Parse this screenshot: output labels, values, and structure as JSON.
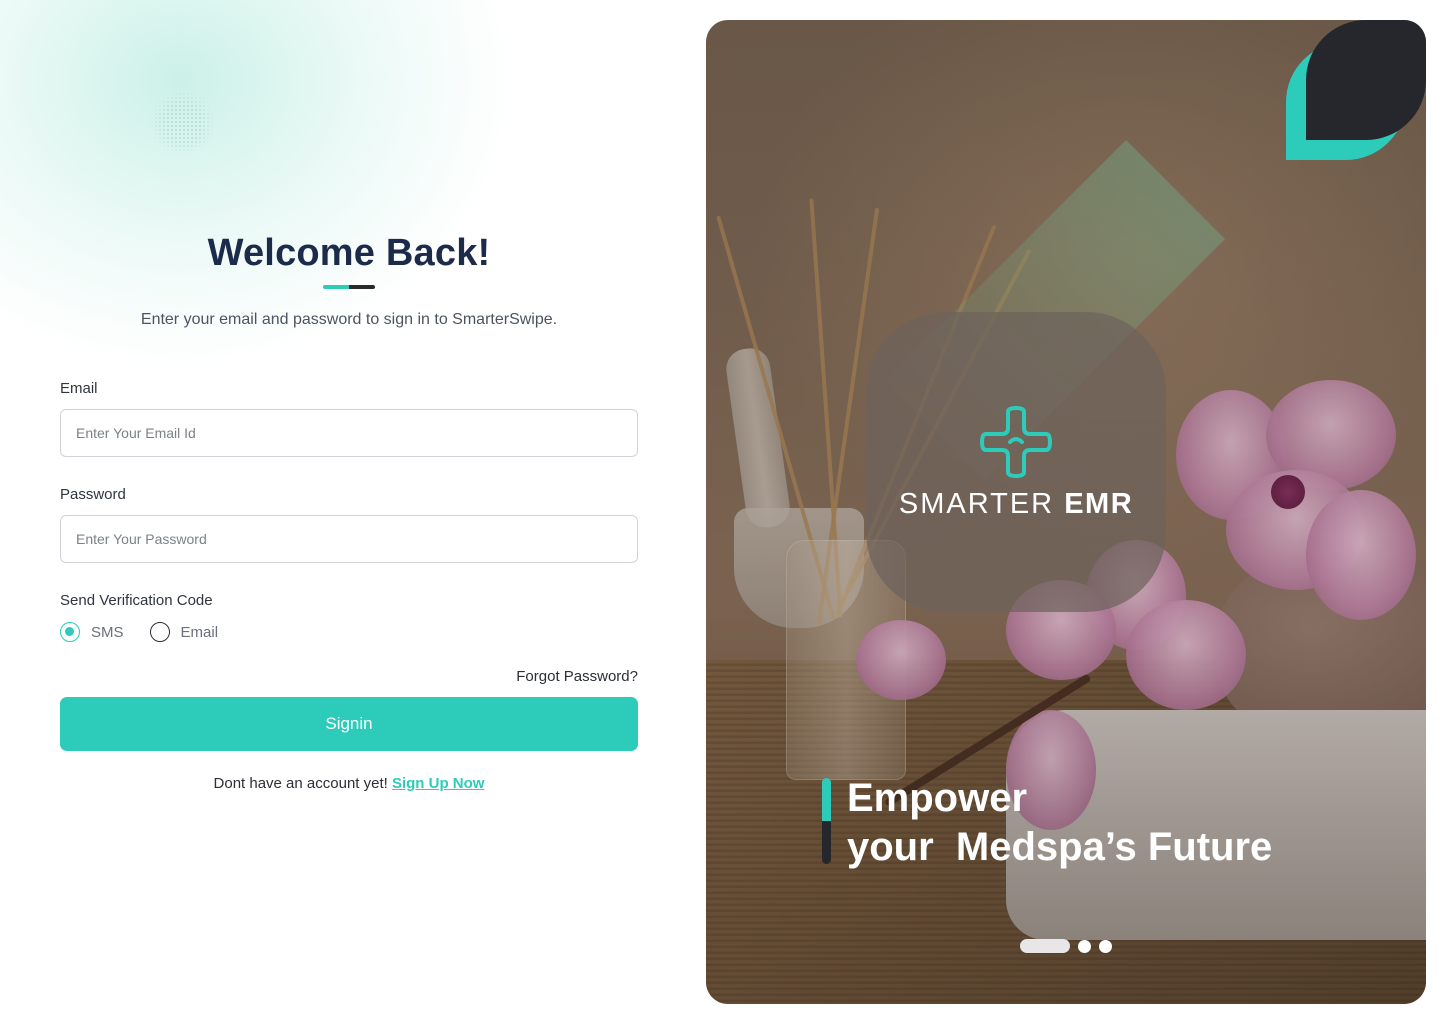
{
  "login": {
    "title": "Welcome Back!",
    "subtitle": "Enter your email and password to sign in to SmarterSwipe.",
    "email": {
      "label": "Email",
      "placeholder": "Enter Your Email Id",
      "value": ""
    },
    "password": {
      "label": "Password",
      "placeholder": "Enter Your Password",
      "value": ""
    },
    "verification": {
      "label": "Send Verification Code",
      "options": [
        {
          "label": "SMS",
          "selected": true
        },
        {
          "label": "Email",
          "selected": false
        }
      ]
    },
    "forgot_password": "Forgot Password?",
    "signin_label": "Signin",
    "signup_prompt": "Dont have an account yet!",
    "signup_link": "Sign Up Now"
  },
  "hero": {
    "logo_light": "SMARTER",
    "logo_bold": "EMR",
    "headline_line1": "Empower",
    "headline_line2": "your  Medspa’s Future",
    "carousel": {
      "count": 3,
      "active_index": 0
    }
  },
  "icons": {
    "logo": "medical-cross-icon",
    "radio": "radio-button-icon"
  },
  "colors": {
    "accent": "#2dcbb9",
    "title": "#1d2b4a",
    "dark": "#26272c"
  }
}
